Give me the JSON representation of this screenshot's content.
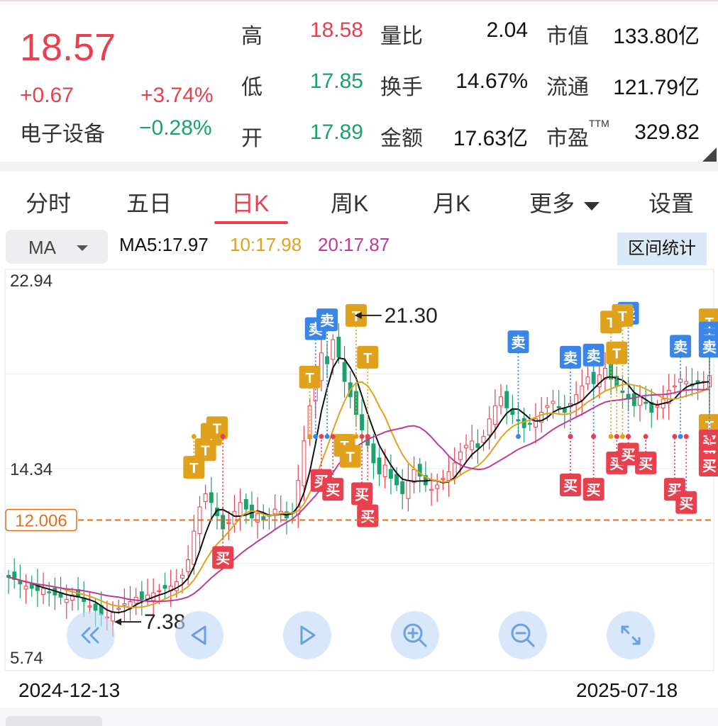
{
  "quote": {
    "price": "18.57",
    "change": "+0.67",
    "change_pct": "+3.74%",
    "sector": "电子设备",
    "sector_change": "−0.28%",
    "stats": [
      {
        "label": "高",
        "value": "18.58",
        "color": "#e8404f"
      },
      {
        "label": "低",
        "value": "17.85",
        "color": "#1aa36a"
      },
      {
        "label": "开",
        "value": "17.89",
        "color": "#1aa36a"
      },
      {
        "label": "量比",
        "value": "2.04",
        "color": "#111111"
      },
      {
        "label": "换手",
        "value": "14.67%",
        "color": "#111111"
      },
      {
        "label": "金额",
        "value": "17.63亿",
        "color": "#111111"
      },
      {
        "label": "市值",
        "value": "133.80亿",
        "color": "#111111"
      },
      {
        "label": "流通",
        "value": "121.79亿",
        "color": "#111111"
      },
      {
        "label": "市盈",
        "label_sup": "TTM",
        "value": "329.82",
        "color": "#111111"
      }
    ]
  },
  "tabs": [
    {
      "label": "分时",
      "active": false
    },
    {
      "label": "五日",
      "active": false
    },
    {
      "label": "日K",
      "active": true
    },
    {
      "label": "周K",
      "active": false
    },
    {
      "label": "月K",
      "active": false
    },
    {
      "label": "更多",
      "active": false,
      "icon": "caret-down-icon"
    },
    {
      "label": "设置",
      "active": false
    }
  ],
  "indicator": {
    "selected": "MA",
    "ma5": "MA5:17.97",
    "ma10": "10:17.98",
    "ma20": "20:17.87",
    "range_button": "区间统计",
    "colors": {
      "ma5": "#111111",
      "ma10": "#e0a21c",
      "ma20": "#c0399a"
    }
  },
  "chart_data": {
    "type": "candlestick",
    "y_top_label": "22.94",
    "y_mid_label": "14.34",
    "y_bottom_label": "5.74",
    "ylim": [
      5.74,
      22.94
    ],
    "reference_price": "12.006",
    "reference_value": 12.006,
    "max_annotation": "21.30",
    "max_value": 21.3,
    "min_annotation": "7.38",
    "min_value": 7.38,
    "x_start": "2024-12-13",
    "x_end": "2025-07-18",
    "closes": [
      9.4,
      9.3,
      9.1,
      9.0,
      8.9,
      8.8,
      8.9,
      8.7,
      8.6,
      8.5,
      8.4,
      8.6,
      8.5,
      8.3,
      8.1,
      7.9,
      7.7,
      7.6,
      7.8,
      8.0,
      8.2,
      8.3,
      8.5,
      8.4,
      8.6,
      8.7,
      8.8,
      8.9,
      9.0,
      9.2,
      9.5,
      10.2,
      11.5,
      12.6,
      13.2,
      12.8,
      12.2,
      11.6,
      11.9,
      12.4,
      12.8,
      12.5,
      12.1,
      12.3,
      12.0,
      12.2,
      12.5,
      12.4,
      12.1,
      12.3,
      13.8,
      15.6,
      17.2,
      18.5,
      19.6,
      19.1,
      20.2,
      19.4,
      18.3,
      17.6,
      16.8,
      16.1,
      15.4,
      14.6,
      14.1,
      14.5,
      13.9,
      13.6,
      13.2,
      13.8,
      14.3,
      14.0,
      13.6,
      13.4,
      13.6,
      13.9,
      14.2,
      14.6,
      15.1,
      15.4,
      15.6,
      15.3,
      15.8,
      16.6,
      17.2,
      17.6,
      17.1,
      16.8,
      16.5,
      16.2,
      16.4,
      16.6,
      16.9,
      17.2,
      17.4,
      17.1,
      16.9,
      17.3,
      17.7,
      18.1,
      18.5,
      18.2,
      18.6,
      18.9,
      18.4,
      18.1,
      17.8,
      17.5,
      17.2,
      17.6,
      17.3,
      16.9,
      17.2,
      17.5,
      17.9,
      18.1,
      18.4,
      18.3,
      18.1,
      18.2,
      18.3,
      18.57
    ],
    "ma_description": "MA5 / MA10 / MA20",
    "markers": [
      {
        "label": "T",
        "index": 34,
        "value": 15.2
      },
      {
        "label": "T",
        "index": 35,
        "value": 15.9
      },
      {
        "label": "T",
        "index": 36,
        "value": 16.2
      },
      {
        "label": "T",
        "index": 32,
        "value": 14.4
      },
      {
        "label": "买",
        "index": 37,
        "value": 10.3
      },
      {
        "label": "卖",
        "index": 53,
        "value": 20.7
      },
      {
        "label": "卖",
        "index": 55,
        "value": 21.1
      },
      {
        "label": "T",
        "index": 60,
        "value": 21.3
      },
      {
        "label": "T",
        "index": 62,
        "value": 19.4
      },
      {
        "label": "T",
        "index": 52,
        "value": 18.5
      },
      {
        "label": "T",
        "index": 58,
        "value": 15.4
      },
      {
        "label": "T",
        "index": 59,
        "value": 14.9
      },
      {
        "label": "买",
        "index": 54,
        "value": 13.8
      },
      {
        "label": "买",
        "index": 56,
        "value": 13.4
      },
      {
        "label": "买",
        "index": 61,
        "value": 13.2
      },
      {
        "label": "买",
        "index": 62,
        "value": 12.2
      },
      {
        "label": "卖",
        "index": 88,
        "value": 20.1
      },
      {
        "label": "卖",
        "index": 97,
        "value": 19.4
      },
      {
        "label": "卖",
        "index": 101,
        "value": 19.5
      },
      {
        "label": "卖",
        "index": 107,
        "value": 21.4
      },
      {
        "label": "T",
        "index": 104,
        "value": 21.0
      },
      {
        "label": "T",
        "index": 106,
        "value": 21.3
      },
      {
        "label": "T",
        "index": 105,
        "value": 19.6
      },
      {
        "label": "卖",
        "index": 116,
        "value": 19.9
      },
      {
        "label": "买",
        "index": 97,
        "value": 13.6
      },
      {
        "label": "买",
        "index": 101,
        "value": 13.4
      },
      {
        "label": "买",
        "index": 105,
        "value": 14.6
      },
      {
        "label": "买",
        "index": 107,
        "value": 15.0
      },
      {
        "label": "买",
        "index": 110,
        "value": 14.6
      },
      {
        "label": "买",
        "index": 115,
        "value": 13.4
      },
      {
        "label": "买",
        "index": 117,
        "value": 12.8
      },
      {
        "label": "T",
        "index": 122,
        "value": 21.1
      },
      {
        "label": "T",
        "index": 126,
        "value": 21.0
      },
      {
        "label": "卖",
        "index": 124,
        "value": 20.5
      },
      {
        "label": "卖",
        "index": 125,
        "value": 20.2
      },
      {
        "label": "T",
        "index": 127,
        "value": 16.3
      },
      {
        "label": "买",
        "index": 128,
        "value": 15.6
      },
      {
        "label": "买",
        "index": 129,
        "value": 14.9
      },
      {
        "label": "卖",
        "index": 140,
        "value": 19.9
      },
      {
        "label": "买",
        "index": 138,
        "value": 14.5
      }
    ],
    "controls": [
      {
        "name": "scroll-left-button",
        "icon": "double-chevron-left-icon"
      },
      {
        "name": "prev-button",
        "icon": "triangle-left-icon"
      },
      {
        "name": "next-button",
        "icon": "triangle-right-icon"
      },
      {
        "name": "zoom-in-button",
        "icon": "zoom-in-icon"
      },
      {
        "name": "zoom-out-button",
        "icon": "zoom-out-icon"
      },
      {
        "name": "fullscreen-button",
        "icon": "expand-icon"
      }
    ],
    "up_color": "#e8404f",
    "down_color": "#1aa36a",
    "buy_color": "#e8404f",
    "sell_color": "#3a86e8",
    "t_color": "#e0a21c",
    "ref_color": "#e0701c"
  }
}
